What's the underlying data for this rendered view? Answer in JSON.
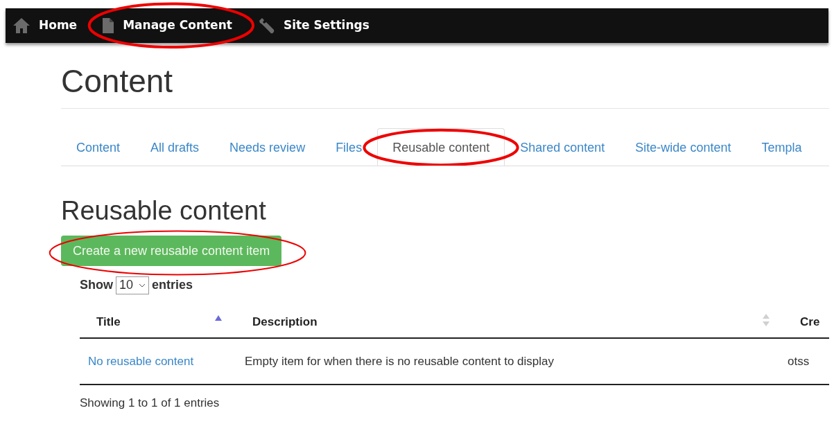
{
  "nav": [
    {
      "kind": "home",
      "label": "Home"
    },
    {
      "kind": "page",
      "label": "Manage Content",
      "highlighted": true
    },
    {
      "kind": "wrench",
      "label": "Site Settings"
    }
  ],
  "page_title": "Content",
  "tabs": [
    {
      "label": "Content",
      "selected": false,
      "highlighted": false
    },
    {
      "label": "All drafts",
      "selected": false,
      "highlighted": false
    },
    {
      "label": "Needs review",
      "selected": false,
      "highlighted": false
    },
    {
      "label": "Files",
      "selected": false,
      "highlighted": false
    },
    {
      "label": "Reusable content",
      "selected": true,
      "highlighted": true
    },
    {
      "label": "Shared content",
      "selected": false,
      "highlighted": false
    },
    {
      "label": "Site-wide content",
      "selected": false,
      "highlighted": false
    },
    {
      "label": "Templa",
      "selected": false,
      "highlighted": false
    }
  ],
  "section_title": "Reusable content",
  "create_button": {
    "label": "Create a new reusable content item",
    "highlighted": true
  },
  "length_menu": {
    "before": "Show",
    "value": "10",
    "after": "entries"
  },
  "table": {
    "columns": [
      {
        "label": "Title",
        "sortable": true,
        "ascending": true
      },
      {
        "label": "Description",
        "sortable": true,
        "ascending": false
      },
      {
        "label": "Cre"
      }
    ],
    "rows": [
      {
        "cells": [
          "No reusable content",
          "Empty item for when there is no reusable content to display",
          "otss"
        ]
      }
    ]
  },
  "info": "Showing 1 to 1 of 1 entries"
}
